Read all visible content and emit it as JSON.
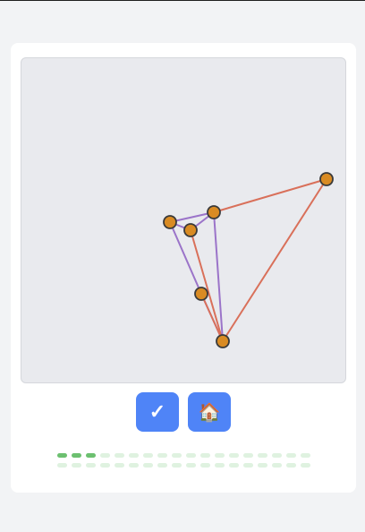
{
  "colors": {
    "board_bg": "#e9eaee",
    "card_bg": "#ffffff",
    "page_bg": "#f2f3f5",
    "accent_button": "#4f84f7",
    "node_fill": "#d98b23",
    "node_stroke": "#3a3a3a",
    "edge_purple": "#9b74c9",
    "edge_orange": "#d9705a",
    "progress_done": "#6cc070",
    "progress_todo": "#dff2e0"
  },
  "controls": {
    "check_icon": "check-icon",
    "check_glyph": "✓",
    "home_icon": "house-icon",
    "home_glyph": "🏠"
  },
  "graph": {
    "nodes": [
      "A",
      "B",
      "C",
      "D",
      "E",
      "F"
    ],
    "edges": [
      {
        "from": "A",
        "to": "C",
        "color": "purple"
      },
      {
        "from": "A",
        "to": "B",
        "color": "purple"
      },
      {
        "from": "A",
        "to": "D",
        "color": "purple"
      },
      {
        "from": "B",
        "to": "C",
        "color": "purple"
      },
      {
        "from": "C",
        "to": "E",
        "color": "orange"
      },
      {
        "from": "D",
        "to": "F",
        "color": "purple"
      },
      {
        "from": "B",
        "to": "F",
        "color": "orange"
      },
      {
        "from": "E",
        "to": "F",
        "color": "orange"
      },
      {
        "from": "F",
        "to": "C",
        "color": "purple"
      },
      {
        "from": "F",
        "to": "D",
        "color": "orange"
      }
    ]
  },
  "progress": {
    "rows": 2,
    "per_row": 18,
    "completed": 3,
    "total": 36
  }
}
